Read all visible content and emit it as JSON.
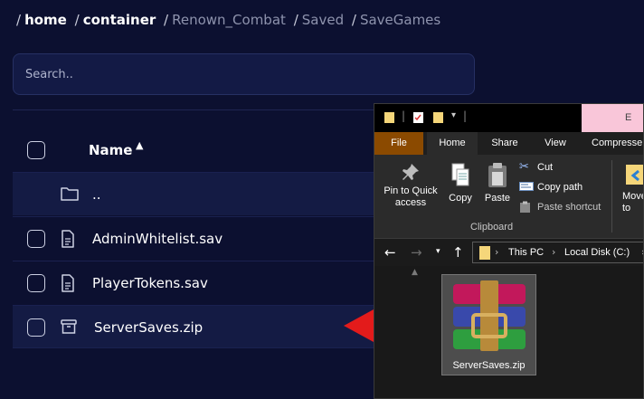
{
  "breadcrumb": {
    "items": [
      "home",
      "container",
      "Renown_Combat",
      "Saved",
      "SaveGames"
    ],
    "separator": "/"
  },
  "search": {
    "placeholder": "Search.."
  },
  "table": {
    "header": {
      "name_label": "Name",
      "sort_icon": "sort-ascending-icon"
    },
    "rows": [
      {
        "name": "..",
        "icon": "folder-icon"
      },
      {
        "name": "AdminWhitelist.sav",
        "icon": "document-icon"
      },
      {
        "name": "PlayerTokens.sav",
        "icon": "document-icon"
      },
      {
        "name": "ServerSaves.zip",
        "icon": "archive-icon"
      }
    ]
  },
  "explorer": {
    "title_tab_text": "E",
    "ribbon_tabs": [
      "File",
      "Home",
      "Share",
      "View",
      "Compresse"
    ],
    "ribbon": {
      "pin": "Pin to Quick access",
      "copy": "Copy",
      "paste": "Paste",
      "cut": "Cut",
      "copy_path": "Copy path",
      "paste_shortcut": "Paste shortcut",
      "group": "Clipboard",
      "move_to": "Move to"
    },
    "address": {
      "this_pc": "This PC",
      "drive": "Local Disk (C:)"
    },
    "file": {
      "name": "ServerSaves.zip",
      "icon": "winrar-archive-icon"
    }
  },
  "colors": {
    "background": "#0c1030",
    "row_highlight": "#141b44",
    "arrow": "#e31b1b",
    "file_tab": "#8b4a00",
    "title_tab": "#f9c6d9"
  }
}
